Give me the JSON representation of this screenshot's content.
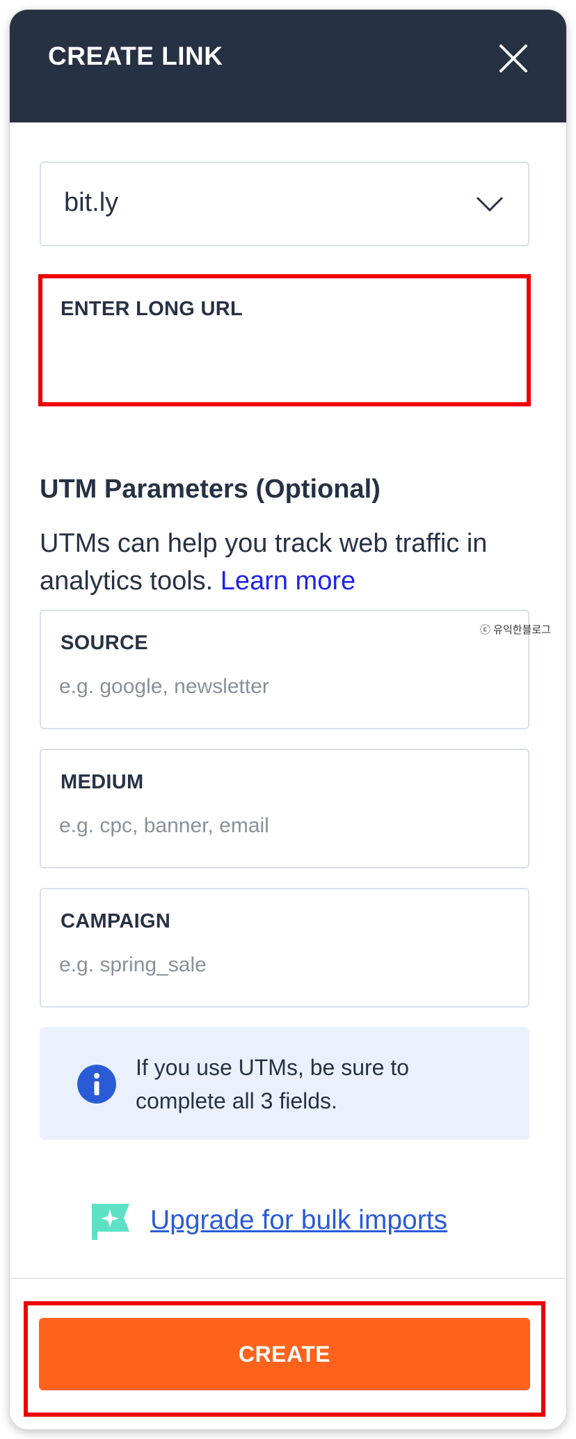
{
  "header": {
    "title": "CREATE LINK",
    "close_icon": "close-icon"
  },
  "domain_select": {
    "value": "bit.ly",
    "icon": "chevron-down-icon"
  },
  "long_url": {
    "label": "ENTER LONG URL",
    "value": "",
    "placeholder": ""
  },
  "utm": {
    "heading": "UTM Parameters (Optional)",
    "description": "UTMs can help you track web traffic in analytics tools.",
    "learn_more": "Learn more",
    "fields": [
      {
        "label": "SOURCE",
        "placeholder": "e.g. google, newsletter"
      },
      {
        "label": "MEDIUM",
        "placeholder": "e.g. cpc, banner, email"
      },
      {
        "label": "CAMPAIGN",
        "placeholder": "e.g. spring_sale"
      }
    ]
  },
  "watermark": "ⓒ 유익한블로그",
  "info": {
    "icon": "info-icon",
    "text": "If you use UTMs, be sure to complete all 3 fields.",
    "color": "#2a5bd7"
  },
  "upgrade": {
    "icon": "sparkle-flag-icon",
    "label": "Upgrade for bulk imports"
  },
  "footer": {
    "create_label": "CREATE"
  },
  "colors": {
    "header_bg": "#273144",
    "accent_orange": "#ff621a",
    "link_blue": "#1f24e6",
    "highlight_red": "#ee0000"
  }
}
